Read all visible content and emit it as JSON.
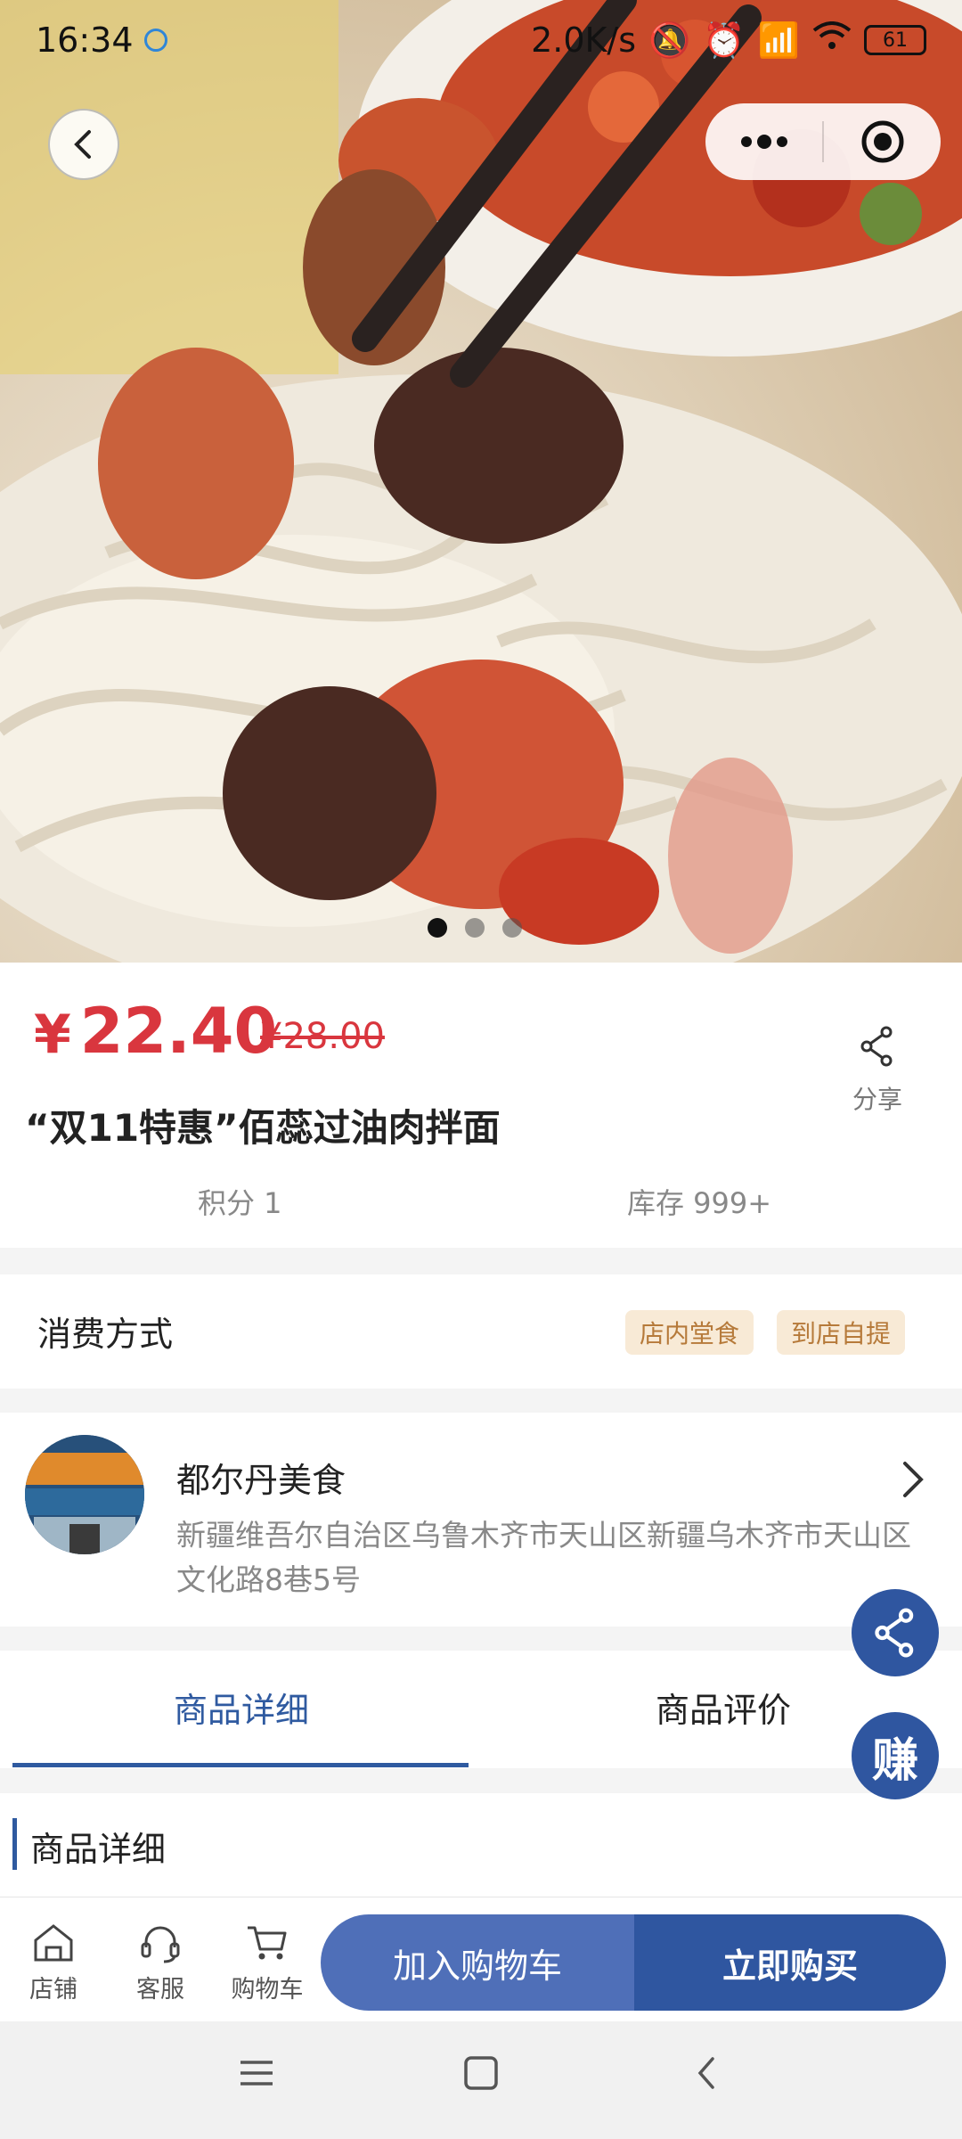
{
  "status_bar": {
    "time": "16:34",
    "net_speed": "2.0K/s",
    "battery": "61"
  },
  "gallery": {
    "total": 3,
    "active_index": 0
  },
  "product": {
    "currency": "¥",
    "price": "22.40",
    "original_price": "¥28.00",
    "title": "“双11特惠”佰蕊过油肉拌面",
    "points": "积分 1",
    "stock": "库存 999+",
    "share_label": "分享"
  },
  "consumption": {
    "label": "消费方式",
    "tags": [
      "店内堂食",
      "到店自提"
    ]
  },
  "store": {
    "name": "都尔丹美食",
    "address": "新疆维吾尔自治区乌鲁木齐市天山区新疆乌木齐市天山区文化路8巷5号"
  },
  "tabs": [
    {
      "label": "商品详细",
      "active": true
    },
    {
      "label": "商品评价",
      "active": false
    }
  ],
  "detail_section": {
    "title": "商品详细"
  },
  "fab": {
    "earn_label": "赚"
  },
  "bottom_nav": {
    "items": [
      {
        "label": "店铺",
        "icon": "store-icon"
      },
      {
        "label": "客服",
        "icon": "headset-icon"
      },
      {
        "label": "购物车",
        "icon": "cart-icon"
      }
    ],
    "add_to_cart": "加入购物车",
    "buy_now": "立即购买"
  },
  "colors": {
    "price_red": "#d9363e",
    "primary_blue": "#2f56a0",
    "secondary_blue": "#4f6fb8",
    "tag_bg": "#f8ead6",
    "tag_text": "#b67a3a"
  }
}
